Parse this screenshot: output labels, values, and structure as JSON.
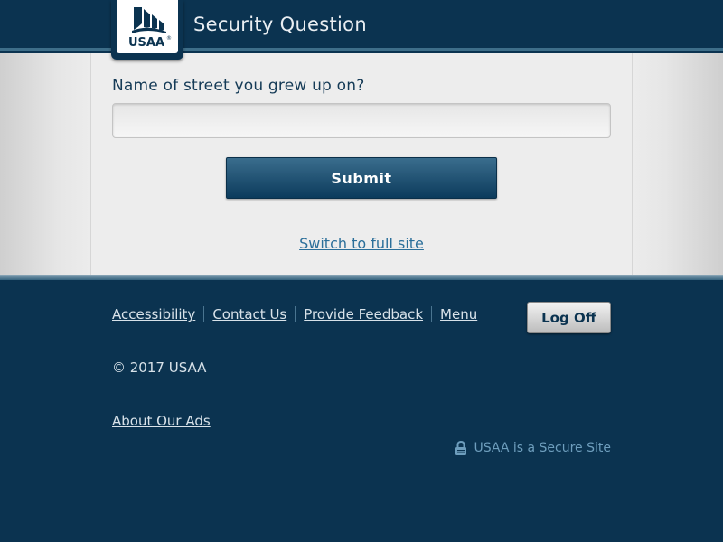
{
  "header": {
    "title": "Security Question",
    "logo_text": "USAA"
  },
  "form": {
    "question_label": "Name of street you grew up on?",
    "answer_value": "",
    "submit_label": "Submit"
  },
  "links": {
    "switch_full_site": "Switch to full site"
  },
  "footer": {
    "nav": [
      {
        "label": "Accessibility"
      },
      {
        "label": "Contact Us"
      },
      {
        "label": "Provide Feedback"
      },
      {
        "label": "Menu"
      }
    ],
    "logoff_label": "Log Off",
    "copyright": "© 2017 USAA",
    "about_ads": "About Our Ads",
    "secure_site": "USAA is a Secure Site"
  },
  "icons": {
    "logo": "usaa-eagle-logo",
    "secure": "lock-icon"
  },
  "colors": {
    "brand_navy": "#0b3350",
    "button_gradient_top": "#3a6d8d",
    "link_blue": "#2b6f9a"
  }
}
